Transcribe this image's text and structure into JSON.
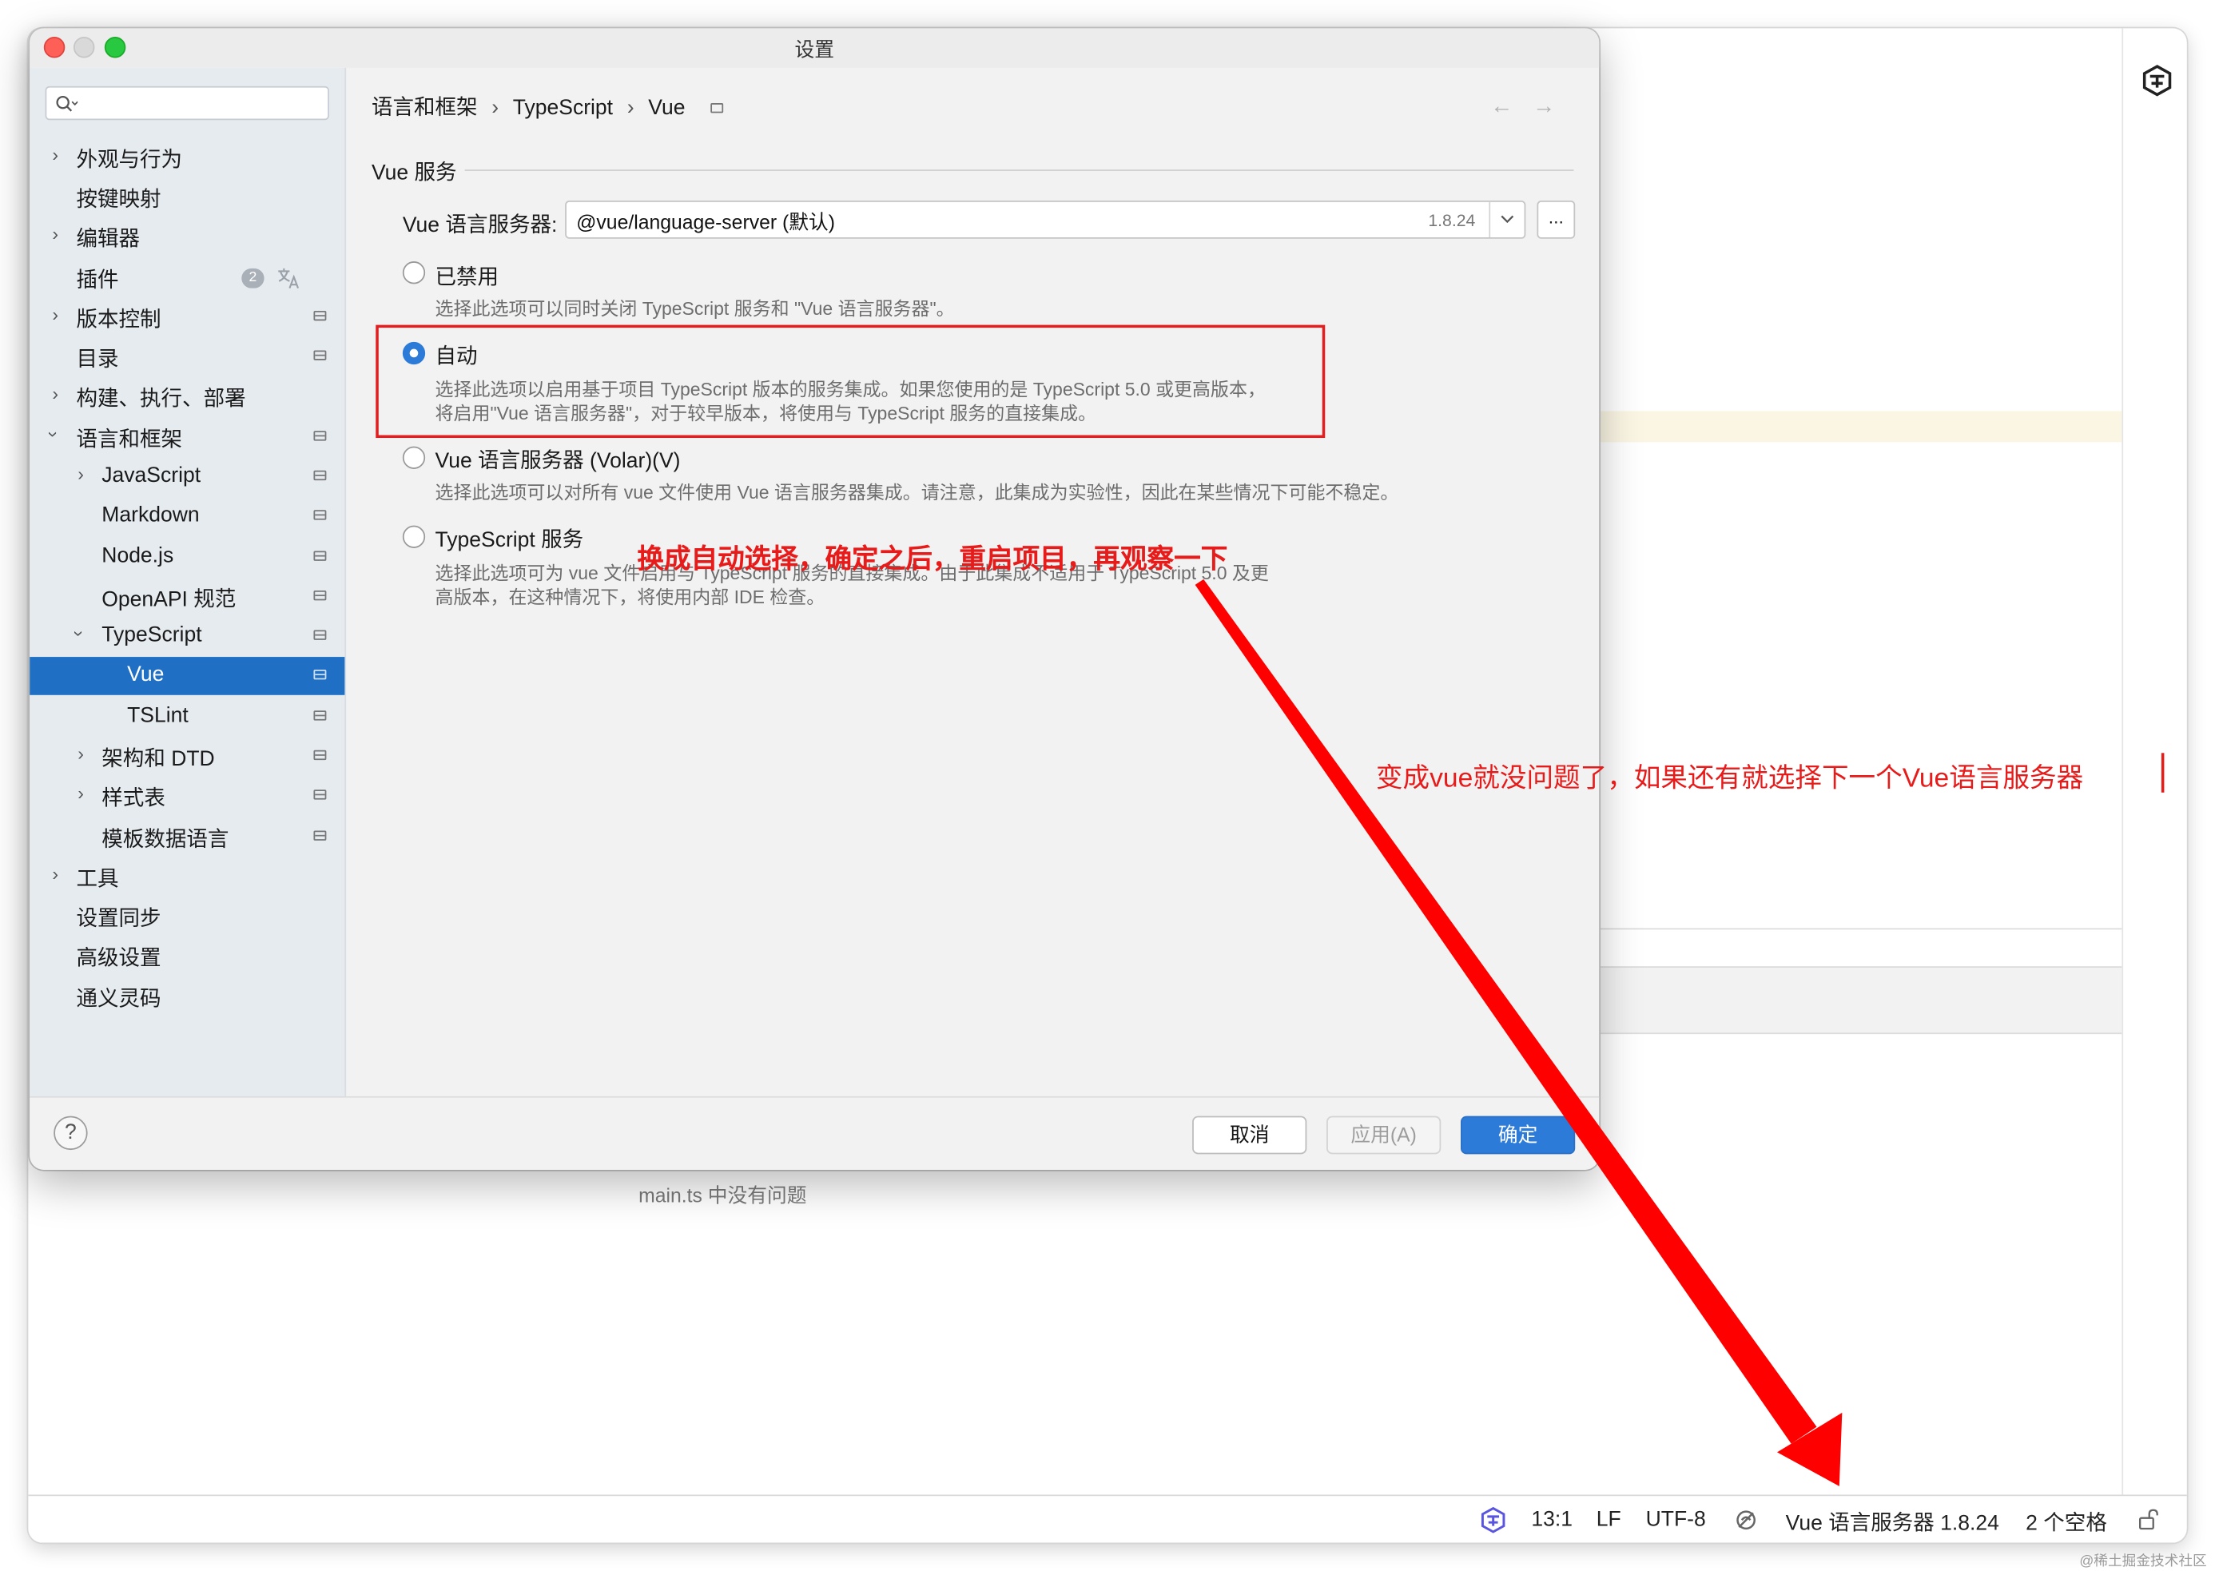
{
  "ide": {
    "status_message": "main.ts 中没有问题",
    "statusbar": {
      "cursor_position": "13:1",
      "line_ending": "LF",
      "encoding": "UTF-8",
      "language_server": "Vue 语言服务器 1.8.24",
      "indent": "2 个空格"
    }
  },
  "dialog": {
    "title": "设置",
    "breadcrumb": [
      "语言和框架",
      "TypeScript",
      "Vue"
    ],
    "sidebar_items": [
      {
        "label": "外观与行为"
      },
      {
        "label": "按键映射"
      },
      {
        "label": "编辑器"
      },
      {
        "label": "插件",
        "badge": "2"
      },
      {
        "label": "版本控制"
      },
      {
        "label": "目录"
      },
      {
        "label": "构建、执行、部署"
      },
      {
        "label": "语言和框架"
      },
      {
        "label": "JavaScript"
      },
      {
        "label": "Markdown"
      },
      {
        "label": "Node.js"
      },
      {
        "label": "OpenAPI 规范"
      },
      {
        "label": "TypeScript"
      },
      {
        "label": "Vue"
      },
      {
        "label": "TSLint"
      },
      {
        "label": "架构和 DTD"
      },
      {
        "label": "样式表"
      },
      {
        "label": "模板数据语言"
      },
      {
        "label": "工具"
      },
      {
        "label": "设置同步"
      },
      {
        "label": "高级设置"
      },
      {
        "label": "通义灵码"
      }
    ],
    "section_title": "Vue 服务",
    "server_field": {
      "label": "Vue 语言服务器:",
      "value": "@vue/language-server (默认)",
      "version": "1.8.24",
      "more_button": "..."
    },
    "options": [
      {
        "label": "已禁用",
        "desc": [
          "选择此选项可以同时关闭 TypeScript 服务和 \"Vue 语言服务器\"。"
        ],
        "selected": false
      },
      {
        "label": "自动",
        "desc": [
          "选择此选项以启用基于项目 TypeScript 版本的服务集成。如果您使用的是 TypeScript 5.0 或更高版本，",
          "将启用\"Vue 语言服务器\"，对于较早版本，将使用与 TypeScript 服务的直接集成。"
        ],
        "selected": true
      },
      {
        "label": "Vue 语言服务器 (Volar)(V)",
        "desc": [
          "选择此选项可以对所有 vue 文件使用 Vue 语言服务器集成。请注意，此集成为实验性，因此在某些情况下可能不稳定。"
        ],
        "selected": false
      },
      {
        "label": "TypeScript 服务",
        "desc": [
          "选择此选项可为 vue 文件启用与 TypeScript 服务的直接集成。由于此集成不适用于 TypeScript 5.0 及更",
          "高版本，在这种情况下，将使用内部 IDE 检查。"
        ],
        "selected": false
      }
    ],
    "buttons": {
      "help": "?",
      "cancel": "取消",
      "apply": "应用(A)",
      "ok": "确定"
    }
  },
  "annotations": {
    "note_1": "换成自动选择，确定之后，重启项目，再观察一下",
    "note_2": "变成vue就没问题了，如果还有就选择下一个Vue语言服务器"
  },
  "watermark": "@稀土掘金技术社区",
  "colors": {
    "accent_blue": "#2d7bd8",
    "selection_blue": "#1f6fc5",
    "annotation_red": "#e81b1b"
  }
}
